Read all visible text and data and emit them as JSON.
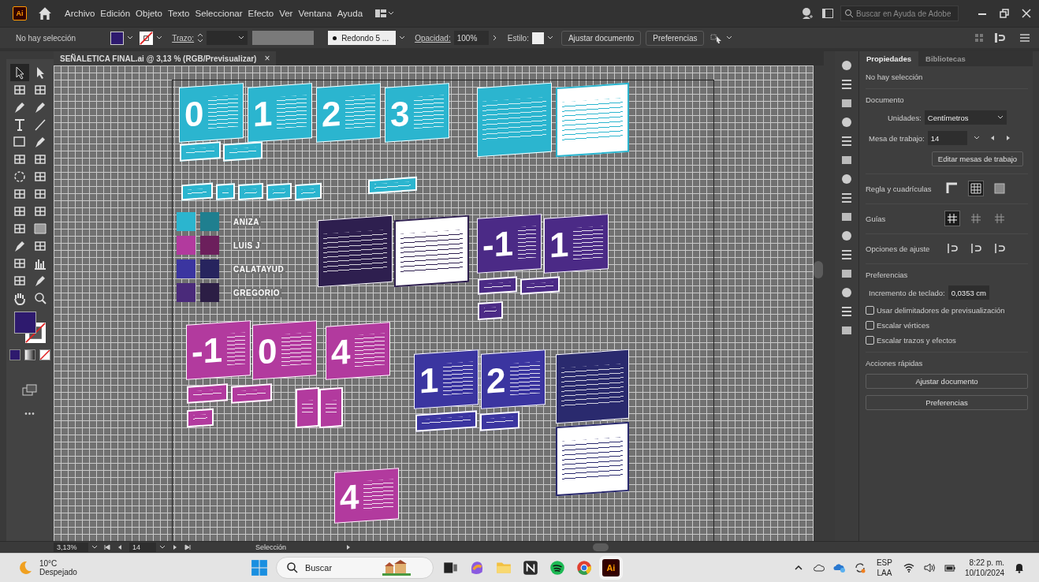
{
  "app_bar": {
    "logo": "Ai",
    "menu": [
      "Archivo",
      "Edición",
      "Objeto",
      "Texto",
      "Seleccionar",
      "Efecto",
      "Ver",
      "Ventana",
      "Ayuda"
    ],
    "search": {
      "placeholder": "Buscar en Ayuda de Adobe"
    }
  },
  "control_bar": {
    "selection": "No hay selección",
    "stroke_label": "Trazo:",
    "brush": "Redondo 5 ...",
    "opacity_label": "Opacidad:",
    "opacity": "100%",
    "style_label": "Estilo:",
    "buttons": [
      "Ajustar documento",
      "Preferencias"
    ]
  },
  "document_tab": {
    "title": "SEÑALETICA FINAL.ai @ 3,13 % (RGB/Previsualizar)",
    "close": "×"
  },
  "toolbar": {
    "tools": [
      {
        "selected": true
      },
      {
        "selected": false
      },
      {
        "selected": false
      },
      {
        "selected": false
      },
      {
        "selected": false
      },
      {
        "selected": false
      },
      {
        "selected": false
      },
      {
        "selected": false
      },
      {
        "selected": false
      },
      {
        "selected": false
      },
      {
        "selected": false
      },
      {
        "selected": false
      },
      {
        "selected": false
      },
      {
        "selected": false
      },
      {
        "selected": false
      },
      {
        "selected": false
      },
      {
        "selected": false
      },
      {
        "selected": false
      },
      {
        "selected": false
      },
      {
        "selected": false
      },
      {
        "selected": false
      },
      {
        "selected": false
      },
      {
        "selected": false
      },
      {
        "selected": false
      },
      {
        "selected": false
      },
      {
        "selected": false
      }
    ],
    "more": "•••"
  },
  "canvas": {
    "signs": [
      {
        "kind": "sign",
        "color": "#2bb5cf",
        "digit": "0"
      },
      {
        "kind": "sign",
        "color": "#2bb5cf",
        "digit": "1"
      },
      {
        "kind": "sign",
        "color": "#2bb5cf",
        "digit": "2"
      },
      {
        "kind": "sign",
        "color": "#2bb5cf",
        "digit": "3"
      },
      {
        "kind": "panel",
        "color": "#2bb5cf"
      },
      {
        "kind": "panel-white",
        "color": "#2bb5cf"
      },
      {
        "kind": "label",
        "color": "#2bb5cf"
      },
      {
        "kind": "label",
        "color": "#2bb5cf"
      },
      {
        "kind": "label",
        "color": "#2bb5cf"
      },
      {
        "kind": "label",
        "color": "#2bb5cf"
      },
      {
        "kind": "label",
        "color": "#2bb5cf"
      },
      {
        "kind": "label",
        "color": "#2bb5cf"
      },
      {
        "kind": "label",
        "color": "#2bb5cf"
      },
      {
        "kind": "label",
        "color": "#2bb5cf"
      },
      {
        "kind": "panel",
        "color": "#2e1f4f"
      },
      {
        "kind": "panel-white",
        "color": "#2e1f4f"
      },
      {
        "kind": "sign",
        "color": "#4b2a86",
        "digit": "-1"
      },
      {
        "kind": "sign",
        "color": "#4b2a86",
        "digit": "1"
      },
      {
        "kind": "label",
        "color": "#4b2a86"
      },
      {
        "kind": "label",
        "color": "#4b2a86"
      },
      {
        "kind": "label",
        "color": "#4b2a86"
      },
      {
        "kind": "sign",
        "color": "#b23a9e",
        "digit": "-1"
      },
      {
        "kind": "sign",
        "color": "#b23a9e",
        "digit": "0"
      },
      {
        "kind": "sign",
        "color": "#b23a9e",
        "digit": "4"
      },
      {
        "kind": "label",
        "color": "#b23a9e"
      },
      {
        "kind": "label",
        "color": "#b23a9e"
      },
      {
        "kind": "label",
        "color": "#b23a9e"
      },
      {
        "kind": "label",
        "color": "#b23a9e"
      },
      {
        "kind": "label",
        "color": "#b23a9e"
      },
      {
        "kind": "sign",
        "color": "#b23a9e",
        "digit": "4"
      },
      {
        "kind": "sign",
        "color": "#3b35a0",
        "digit": "1"
      },
      {
        "kind": "sign",
        "color": "#3b35a0",
        "digit": "2"
      },
      {
        "kind": "panel",
        "color": "#2a2a6e"
      },
      {
        "kind": "panel-white",
        "color": "#2a2a6e"
      },
      {
        "kind": "label",
        "color": "#3b35a0"
      },
      {
        "kind": "label",
        "color": "#3b35a0"
      }
    ],
    "swatches": [
      {
        "label": "ANIZA",
        "tones": [
          {
            "color": "#2bb5cf"
          },
          {
            "color": "#1f7f8f"
          }
        ]
      },
      {
        "label": "LUIS J",
        "tones": [
          {
            "color": "#b23a9e"
          },
          {
            "color": "#6c1f5c"
          }
        ]
      },
      {
        "label": "CALATAYUD",
        "tones": [
          {
            "color": "#3b35a0"
          },
          {
            "color": "#27245e"
          }
        ]
      },
      {
        "label": "GREGORIO",
        "tones": [
          {
            "color": "#4a2a7a"
          },
          {
            "color": "#2c1e45"
          }
        ]
      }
    ]
  },
  "properties_panel": {
    "tabs": [
      {
        "label": "Propiedades",
        "selected": true
      },
      {
        "label": "Bibliotecas",
        "selected": false
      }
    ],
    "selection": "No hay selección",
    "document_heading": "Documento",
    "units_label": "Unidades:",
    "units": "Centímetros",
    "artboard_label": "Mesa de trabajo:",
    "artboard": "14",
    "edit_artboards": "Editar mesas de trabajo",
    "rulers_label": "Regla y cuadrículas",
    "rulers": [
      {
        "selected": false
      },
      {
        "selected": true
      },
      {
        "selected": false
      }
    ],
    "guides_label": "Guías",
    "guides": [
      {
        "selected": true
      },
      {
        "selected": false
      },
      {
        "selected": false
      }
    ],
    "snap_label": "Opciones de ajuste",
    "snap": [
      {
        "selected": false
      },
      {
        "selected": false
      },
      {
        "selected": false
      }
    ],
    "preferences_heading": "Preferencias",
    "increment_label": "Incremento de teclado:",
    "increment": "0,0353 cm",
    "checkboxes": [
      {
        "label": "Usar delimitadores de previsualización",
        "checked": false
      },
      {
        "label": "Escalar vértices",
        "checked": false
      },
      {
        "label": "Escalar trazos y efectos",
        "checked": false
      }
    ],
    "quick_actions_heading": "Acciones rápidas",
    "quick_actions": [
      "Ajustar documento",
      "Preferencias"
    ]
  },
  "status_bar": {
    "zoom": "3,13%",
    "artboard": "14",
    "tool": "Selección"
  },
  "taskbar": {
    "app_icon": "Ai",
    "weather": {
      "temperature": "10°C",
      "condition": "Despejado"
    },
    "search": {
      "placeholder": "Buscar"
    },
    "language": [
      "ESP",
      "LAA"
    ],
    "time": "8:22 p. m.",
    "date": "10/10/2024"
  }
}
